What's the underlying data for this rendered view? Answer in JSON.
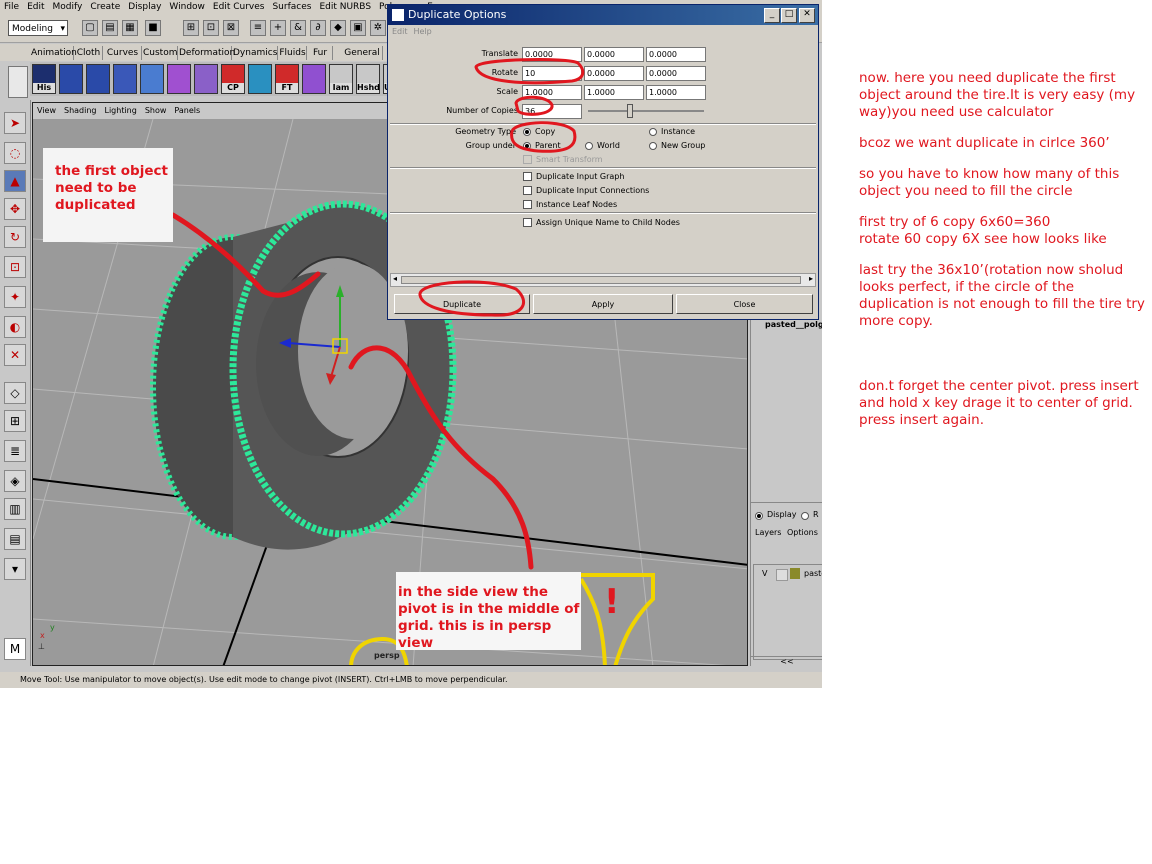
{
  "menubar": [
    "File",
    "Edit",
    "Modify",
    "Create",
    "Display",
    "Window",
    "Edit Curves",
    "Surfaces",
    "Edit NURBS",
    "Polygons",
    "E"
  ],
  "mode_select": "Modeling",
  "shelf_tabs": [
    "Animation",
    "Cloth",
    "Curves",
    "Custom",
    "Deformation",
    "Dynamics",
    "Fluids",
    "Fur",
    "General"
  ],
  "shelf_icons": [
    "His",
    "",
    "",
    "",
    "",
    "",
    "",
    "CP",
    "",
    "FT",
    "",
    "Iam",
    "Hshd",
    "U"
  ],
  "viewport": {
    "menu": [
      "View",
      "Shading",
      "Lighting",
      "Show",
      "Panels"
    ],
    "camera_label": "persp",
    "axis_x": "x",
    "axis_y": "y"
  },
  "dialog": {
    "title": "Duplicate Options",
    "menu": [
      "Edit",
      "Help"
    ],
    "translate_label": "Translate",
    "translate": [
      "0.0000",
      "0.0000",
      "0.0000"
    ],
    "rotate_label": "Rotate",
    "rotate": [
      "10",
      "0.0000",
      "0.0000"
    ],
    "scale_label": "Scale",
    "scale": [
      "1.0000",
      "1.0000",
      "1.0000"
    ],
    "copies_label": "Number of Copies",
    "copies": "36",
    "geometry_type_label": "Geometry Type",
    "geometry_copy": "Copy",
    "geometry_instance": "Instance",
    "group_under_label": "Group under",
    "group_parent": "Parent",
    "group_world": "World",
    "group_new": "New Group",
    "smart_transform": "Smart Transform",
    "dup_input_graph": "Duplicate Input Graph",
    "dup_input_conn": "Duplicate Input Connections",
    "instance_leaf": "Instance Leaf Nodes",
    "assign_unique": "Assign Unique Name to Child Nodes",
    "btn_duplicate": "Duplicate",
    "btn_apply": "Apply",
    "btn_close": "Close"
  },
  "right_panel": {
    "object_name": "pasted__polg",
    "display_label": "Display",
    "r_label": "R",
    "layers": "Layers",
    "options": "Options",
    "layer_v": "V",
    "layer_name": "paste",
    "collapse": "<<"
  },
  "status_line": "Move Tool: Use manipulator to move object(s). Use edit mode to change pivot (INSERT). Ctrl+LMB to move perpendicular.",
  "annotations": {
    "first_object": "the first object need to be duplicated",
    "side_view": "in the side view the pivot is in the middle of grid. this is in persp view",
    "exclamation": "!",
    "notes": [
      "now. here you need duplicate the first object around the tire.It is very easy (my way)you need use calculator",
      "bcoz we want duplicate in cirlce  360’",
      "so you have to know how many of this object you need to fill the circle",
      "first try of 6 copy    6x60=360\nrotate 60 copy 6X  see how looks like",
      "last try the 36x10’(rotation now sholud looks perfect, if the circle of the duplication is not enough to fill the tire try more copy.",
      "don.t forget the center pivot. press insert and hold x key drage it to center of grid. press insert again."
    ]
  },
  "colors": {
    "annotation_red": "#e0171f",
    "annotation_yellow": "#f0d400",
    "wireframe_green": "#2de89a",
    "title_blue": "#0a246a"
  }
}
